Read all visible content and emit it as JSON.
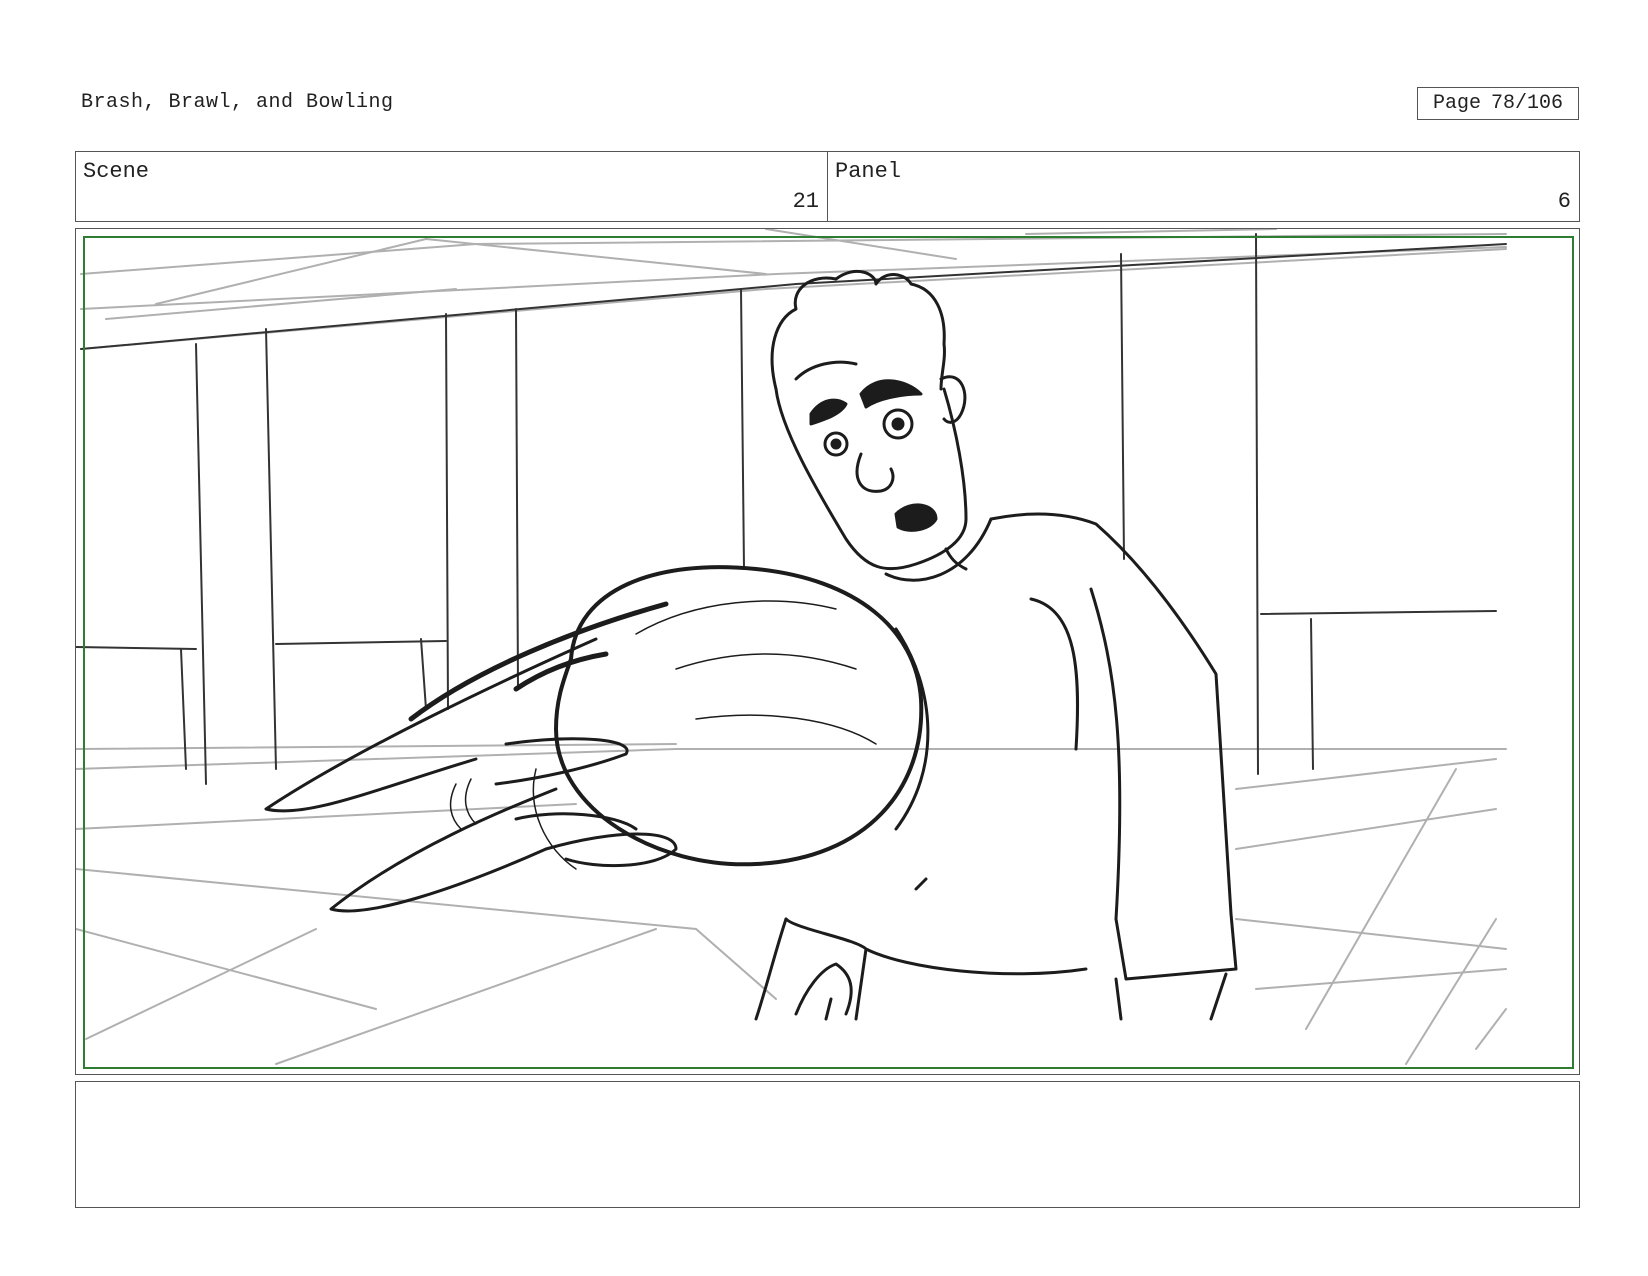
{
  "document": {
    "title": "Brash, Brawl, and Bowling"
  },
  "page_indicator": {
    "label": "Page",
    "value": "78/106"
  },
  "header": {
    "scene": {
      "label": "Scene",
      "value": "21"
    },
    "panel": {
      "label": "Panel",
      "value": "6"
    }
  },
  "colors": {
    "safe_area": "#2e7d32",
    "sketch": "#222222",
    "guides": "#b5b5b5"
  },
  "notes": {
    "text": ""
  }
}
